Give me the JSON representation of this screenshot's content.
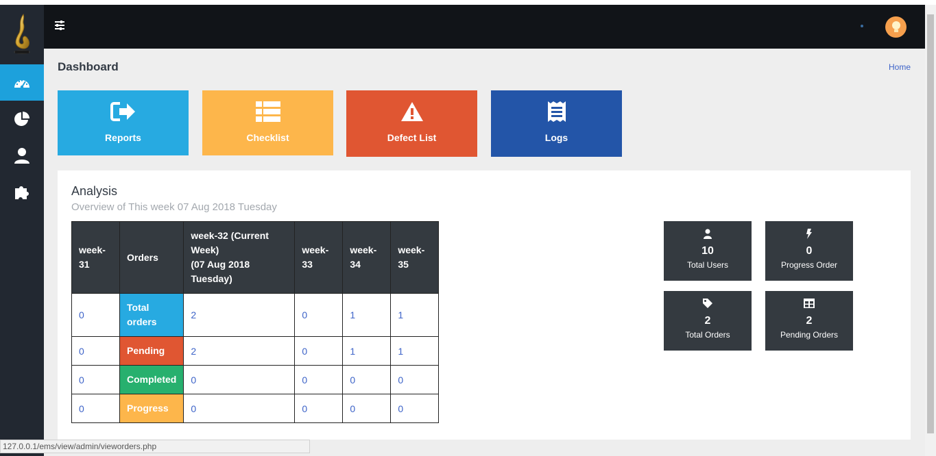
{
  "page": {
    "title": "Dashboard",
    "breadcrumb": "Home"
  },
  "sidebar": {
    "items": [
      {
        "name": "dashboard",
        "icon": "tachometer-icon",
        "active": true
      },
      {
        "name": "charts",
        "icon": "pie-chart-icon",
        "active": false
      },
      {
        "name": "users",
        "icon": "user-icon",
        "active": false
      },
      {
        "name": "plugins",
        "icon": "puzzle-icon",
        "active": false
      }
    ]
  },
  "tiles": [
    {
      "label": "Reports",
      "icon": "sign-out-icon",
      "color": "#27aae1"
    },
    {
      "label": "Checklist",
      "icon": "list-icon",
      "color": "#fdb64b"
    },
    {
      "label": "Defect List",
      "icon": "warning-icon",
      "color": "#e05632"
    },
    {
      "label": "Logs",
      "icon": "receipt-icon",
      "color": "#2355a8"
    }
  ],
  "analysis": {
    "title": "Analysis",
    "subtitle": "Overview of This week 07 Aug 2018 Tuesday",
    "headers": [
      "week-31",
      "Orders",
      "week-32 (Current Week)",
      "(07 Aug 2018 Tuesday)",
      "week-33",
      "week-34",
      "week-35"
    ],
    "rows": [
      {
        "label": "Total orders",
        "values": [
          "0",
          "2",
          "0",
          "1",
          "1"
        ]
      },
      {
        "label": "Pending",
        "values": [
          "0",
          "2",
          "0",
          "1",
          "1"
        ]
      },
      {
        "label": "Completed",
        "values": [
          "0",
          "0",
          "0",
          "0",
          "0"
        ]
      },
      {
        "label": "Progress",
        "values": [
          "0",
          "0",
          "0",
          "0",
          "0"
        ]
      }
    ]
  },
  "stats": [
    {
      "value": "10",
      "label": "Total Users",
      "icon": "user-icon"
    },
    {
      "value": "0",
      "label": "Progress Order",
      "icon": "bolt-icon"
    },
    {
      "value": "2",
      "label": "Total Orders",
      "icon": "tag-icon"
    },
    {
      "value": "2",
      "label": "Pending Orders",
      "icon": "table-icon"
    }
  ],
  "status_url": "127.0.0.1/ems/view/admin/vieworders.php",
  "colors": {
    "accent": "#1da1dc",
    "sidebar": "#222831",
    "topbar": "#111418",
    "link": "#3d63c8"
  }
}
